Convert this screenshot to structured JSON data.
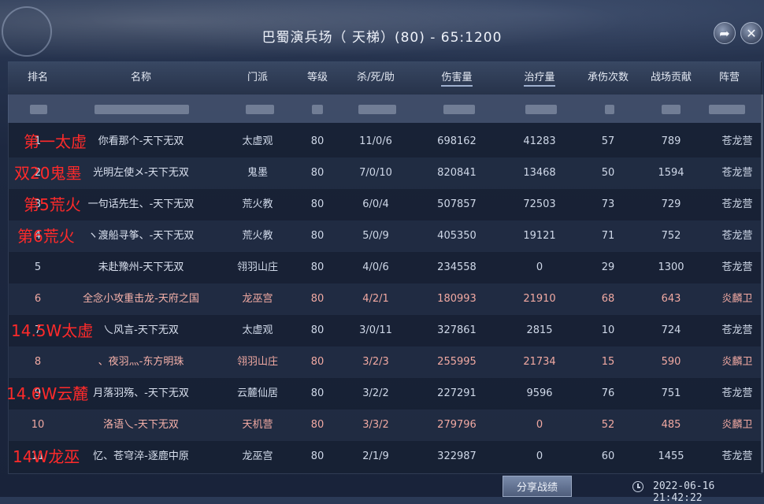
{
  "window": {
    "title": "巴蜀演兵场（ 天梯）(80) - 65:1200",
    "share_icon": "share-arrow-icon",
    "close_icon": "close-icon"
  },
  "columns": [
    "排名",
    "名称",
    "门派",
    "等级",
    "杀/死/助",
    "伤害量",
    "治疗量",
    "承伤次数",
    "战场贡献",
    "阵营"
  ],
  "rows": [
    {
      "rank": "1",
      "name": "你看那个-天下无双",
      "sect": "太虚观",
      "level": "80",
      "kda": "11/0/6",
      "damage": "698162",
      "heal": "41283",
      "hits": "57",
      "contribution": "789",
      "camp": "苍龙营"
    },
    {
      "rank": "2",
      "name": "光明左使メ-天下无双",
      "sect": "鬼墨",
      "level": "80",
      "kda": "7/0/10",
      "damage": "820841",
      "heal": "13468",
      "hits": "50",
      "contribution": "1594",
      "camp": "苍龙营"
    },
    {
      "rank": "3",
      "name": "一句话先生、-天下无双",
      "sect": "荒火教",
      "level": "80",
      "kda": "6/0/4",
      "damage": "507857",
      "heal": "72503",
      "hits": "73",
      "contribution": "729",
      "camp": "苍龙营"
    },
    {
      "rank": "4",
      "name": "ヽ渡船寻筝、-天下无双",
      "sect": "荒火教",
      "level": "80",
      "kda": "5/0/9",
      "damage": "405350",
      "heal": "19121",
      "hits": "71",
      "contribution": "752",
      "camp": "苍龙营"
    },
    {
      "rank": "5",
      "name": "未赴豫州-天下无双",
      "sect": "翎羽山庄",
      "level": "80",
      "kda": "4/0/6",
      "damage": "234558",
      "heal": "0",
      "hits": "29",
      "contribution": "1300",
      "camp": "苍龙营"
    },
    {
      "rank": "6",
      "name": "全念小攻重击龙-天府之国",
      "sect": "龙巫宫",
      "level": "80",
      "kda": "4/2/1",
      "damage": "180993",
      "heal": "21910",
      "hits": "68",
      "contribution": "643",
      "camp": "炎麟卫"
    },
    {
      "rank": "7",
      "name": "乀风言-天下无双",
      "sect": "太虚观",
      "level": "80",
      "kda": "3/0/11",
      "damage": "327861",
      "heal": "2815",
      "hits": "10",
      "contribution": "724",
      "camp": "苍龙营"
    },
    {
      "rank": "8",
      "name": "、夜羽灬-东方明珠",
      "sect": "翎羽山庄",
      "level": "80",
      "kda": "3/2/3",
      "damage": "255995",
      "heal": "21734",
      "hits": "15",
      "contribution": "590",
      "camp": "炎麟卫"
    },
    {
      "rank": "9",
      "name": "月落羽殇、-天下无双",
      "sect": "云麓仙居",
      "level": "80",
      "kda": "3/2/2",
      "damage": "227291",
      "heal": "9596",
      "hits": "76",
      "contribution": "751",
      "camp": "苍龙营"
    },
    {
      "rank": "10",
      "name": "洛语乀-天下无双",
      "sect": "天机营",
      "level": "80",
      "kda": "3/3/2",
      "damage": "279796",
      "heal": "0",
      "hits": "52",
      "contribution": "485",
      "camp": "炎麟卫"
    },
    {
      "rank": "11",
      "name": "忆、苍穹淬-逐鹿中原",
      "sect": "龙巫宫",
      "level": "80",
      "kda": "2/1/9",
      "damage": "322987",
      "heal": "0",
      "hits": "60",
      "contribution": "1455",
      "camp": "苍龙营"
    }
  ],
  "annotations": [
    "第一太虚",
    "双20鬼墨",
    "第5荒火",
    "第6荒火",
    "14.5W太虚",
    "14.6W云麓",
    "14W龙巫"
  ],
  "footer": {
    "share_label": "分享战绩",
    "timestamp": "2022-06-16 21:42:22",
    "clock_icon": "clock-icon"
  },
  "colors": {
    "camp_dragon": "#cfd8e8",
    "camp_qilin": "#f1a9a2",
    "annotation": "#ff2a2a"
  }
}
